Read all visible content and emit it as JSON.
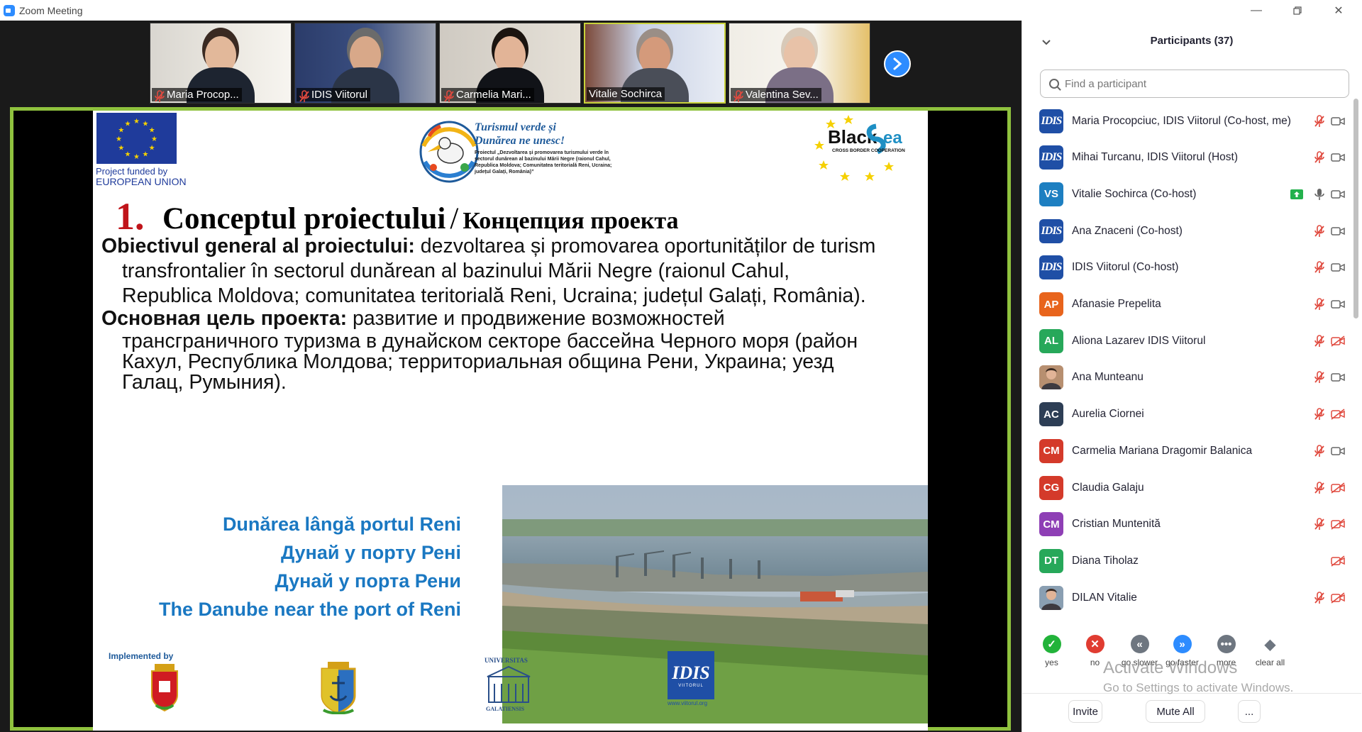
{
  "window": {
    "title": "Zoom Meeting"
  },
  "thumbnails": [
    {
      "name": "Maria Procop...",
      "muted": true,
      "active": false
    },
    {
      "name": "IDIS Viitorul",
      "muted": true,
      "active": false
    },
    {
      "name": "Carmelia Mari...",
      "muted": true,
      "active": false
    },
    {
      "name": "Vitalie Sochirca",
      "muted": false,
      "active": true
    },
    {
      "name": "Valentina Sev...",
      "muted": true,
      "active": false
    }
  ],
  "slide": {
    "eu_caption_1": "Project  funded  by",
    "eu_caption_2": "EUROPEAN UNION",
    "logo_title_1": "Turismul verde și",
    "logo_title_2": "Dunărea ne unesc!",
    "logo_small": "Proiectul „Dezvoltarea și promovarea turismului verde în sectorul dunărean al bazinului Mării Negre (raionul Cahul, Republica Moldova; Comunitatea teritorială Reni, Ucraina; județul Galați, România)”",
    "bs_word_1": "Black",
    "bs_word_2": "Sea",
    "bs_sub": "CROSS BORDER COOPERATION",
    "number": "1.",
    "title_ro": "Conceptul proiectului",
    "title_sep": "/",
    "title_ru": "Концепция проекта",
    "p1_bold": "Obiectivul general al proiectului:",
    "p1_text_1": " dezvoltarea și promovarea oportunităților de turism",
    "p1_text_2": "transfrontalier în sectorul dunărean al bazinului Mării Negre (raionul Cahul,",
    "p1_text_3": "Republica Moldova; comunitatea teritorială Reni, Ucraina; județul Galați, România).",
    "p2_bold": "Основная цель проекта:",
    "p2_text_1": " развитие и продвижение возможностей",
    "p2_text_2": "трансграничного туризма в дунайском секторе бассейна Черного моря (район",
    "p2_text_3": "Кахул, Республика Молдова; территориальная община Рени, Украина; уезд",
    "p2_text_4": "Галац, Румыния).",
    "caption": [
      "Dunărea lângă portul Reni",
      "Дунай у порту Рені",
      "Дунай у порта Рени",
      "The Danube near the port of Reni"
    ],
    "implemented_by": "Implemented by",
    "univ_label": "UNIVERSITAS",
    "univ_label_2": "GALATIENSIS",
    "idis_url": "www.viitorul.org",
    "idis_text": "IDIS",
    "idis_sub": "VIITORUL"
  },
  "panel": {
    "title": "Participants (37)",
    "search_placeholder": "Find a participant",
    "participants": [
      {
        "name": "Maria Procopciuc, IDIS Viitorul (Co-host, me)",
        "avatar": "idis",
        "initials": "IDIS",
        "color": "#1f4fa6",
        "mic": "off",
        "video": "on"
      },
      {
        "name": "Mihai Turcanu, IDIS Viitorul (Host)",
        "avatar": "idis",
        "initials": "IDIS",
        "color": "#1f4fa6",
        "mic": "off",
        "video": "on"
      },
      {
        "name": "Vitalie Sochirca (Co-host)",
        "avatar": "initials",
        "initials": "VS",
        "color": "#1d7fc1",
        "mic": "on",
        "video": "on",
        "sharing": true
      },
      {
        "name": "Ana Znaceni (Co-host)",
        "avatar": "idis",
        "initials": "IDIS",
        "color": "#1f4fa6",
        "mic": "off",
        "video": "on"
      },
      {
        "name": "IDIS Viitorul (Co-host)",
        "avatar": "idis",
        "initials": "IDIS",
        "color": "#1f4fa6",
        "mic": "off",
        "video": "on"
      },
      {
        "name": "Afanasie Prepelita",
        "avatar": "initials",
        "initials": "AP",
        "color": "#e8641c",
        "mic": "off",
        "video": "on"
      },
      {
        "name": "Aliona Lazarev IDIS Viitorul",
        "avatar": "initials",
        "initials": "AL",
        "color": "#27a85a",
        "mic": "off",
        "video": "off"
      },
      {
        "name": "Ana Munteanu",
        "avatar": "photo",
        "initials": "",
        "color": "#b78f70",
        "mic": "off",
        "video": "on"
      },
      {
        "name": "Aurelia Ciornei",
        "avatar": "initials",
        "initials": "AC",
        "color": "#2d3e55",
        "mic": "off",
        "video": "off"
      },
      {
        "name": "Carmelia Mariana Dragomir Balanica",
        "avatar": "initials",
        "initials": "CM",
        "color": "#d43a2a",
        "mic": "off",
        "video": "on"
      },
      {
        "name": "Claudia Galaju",
        "avatar": "initials",
        "initials": "CG",
        "color": "#d43a2a",
        "mic": "off",
        "video": "off"
      },
      {
        "name": "Cristian Muntenită",
        "avatar": "initials",
        "initials": "CM",
        "color": "#8e3fb5",
        "mic": "off",
        "video": "off"
      },
      {
        "name": "Diana Tiholaz",
        "avatar": "initials",
        "initials": "DT",
        "color": "#27a85a",
        "mic": "none",
        "video": "off"
      },
      {
        "name": "DILAN Vitalie",
        "avatar": "photo",
        "initials": "",
        "color": "#8a9fb2",
        "mic": "off",
        "video": "off"
      }
    ],
    "reactions": [
      {
        "label": "yes",
        "color": "#22b33a",
        "glyph": "✓"
      },
      {
        "label": "no",
        "color": "#e03c31",
        "glyph": "✕"
      },
      {
        "label": "go slower",
        "color": "#6e7680",
        "glyph": "«"
      },
      {
        "label": "go faster",
        "color": "#2d8cff",
        "glyph": "»"
      },
      {
        "label": "more",
        "color": "#6e7680",
        "glyph": "•••"
      },
      {
        "label": "clear all",
        "color": "#6e7680",
        "glyph": "◆"
      }
    ],
    "invite_label": "Invite",
    "mute_all_label": "Mute All",
    "more_label": "..."
  },
  "watermark": {
    "line1": "Activate Windows",
    "line2": "Go to Settings to activate Windows."
  }
}
